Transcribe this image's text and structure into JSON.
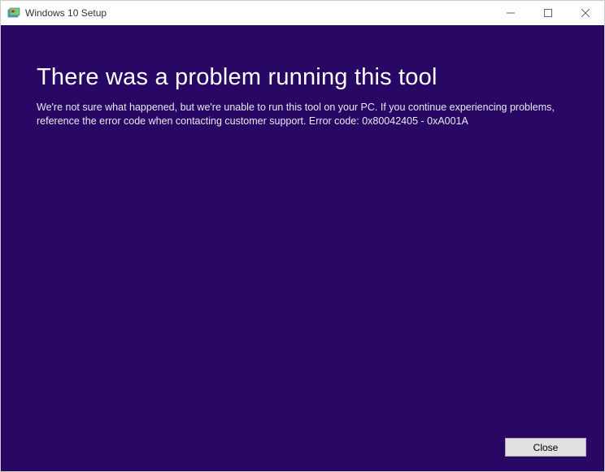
{
  "window": {
    "title": "Windows 10 Setup"
  },
  "content": {
    "heading": "There was a problem running this tool",
    "body": "We're not sure what happened, but we're unable to run this tool on your PC. If you continue experiencing problems, reference the error code when contacting customer support. Error code: 0x80042405 - 0xA001A"
  },
  "footer": {
    "close_label": "Close"
  }
}
